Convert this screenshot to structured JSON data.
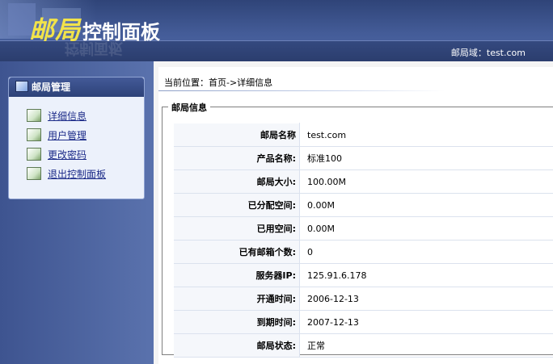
{
  "header": {
    "logo_main": "邮局",
    "logo_sub": "控制面板",
    "reflection": "控制面板",
    "domain_label": "邮局域：test.com"
  },
  "sidebar": {
    "title": "邮局管理",
    "items": [
      {
        "label": "详细信息"
      },
      {
        "label": "用户管理"
      },
      {
        "label": "更改密码"
      },
      {
        "label": "退出控制面板"
      }
    ]
  },
  "main": {
    "breadcrumb": "当前位置：首页->详细信息",
    "legend": "邮局信息",
    "rows": [
      {
        "label": "邮局名称",
        "value": "test.com"
      },
      {
        "label": "产品名称:",
        "value": "标准100"
      },
      {
        "label": "邮局大小:",
        "value": "100.00M"
      },
      {
        "label": "已分配空间:",
        "value": "0.00M"
      },
      {
        "label": "已用空间:",
        "value": "0.00M"
      },
      {
        "label": "已有邮箱个数:",
        "value": "0"
      },
      {
        "label": "服务器IP:",
        "value": "125.91.6.178"
      },
      {
        "label": "开通时间:",
        "value": "2006-12-13"
      },
      {
        "label": "到期时间:",
        "value": "2007-12-13"
      },
      {
        "label": "邮局状态:",
        "value": "正常"
      }
    ]
  },
  "colors": {
    "header_bg": "#445c98",
    "logo_yellow": "#f2e34a",
    "sidebar_bg": "#4e66a3",
    "link": "#1b2a88"
  }
}
